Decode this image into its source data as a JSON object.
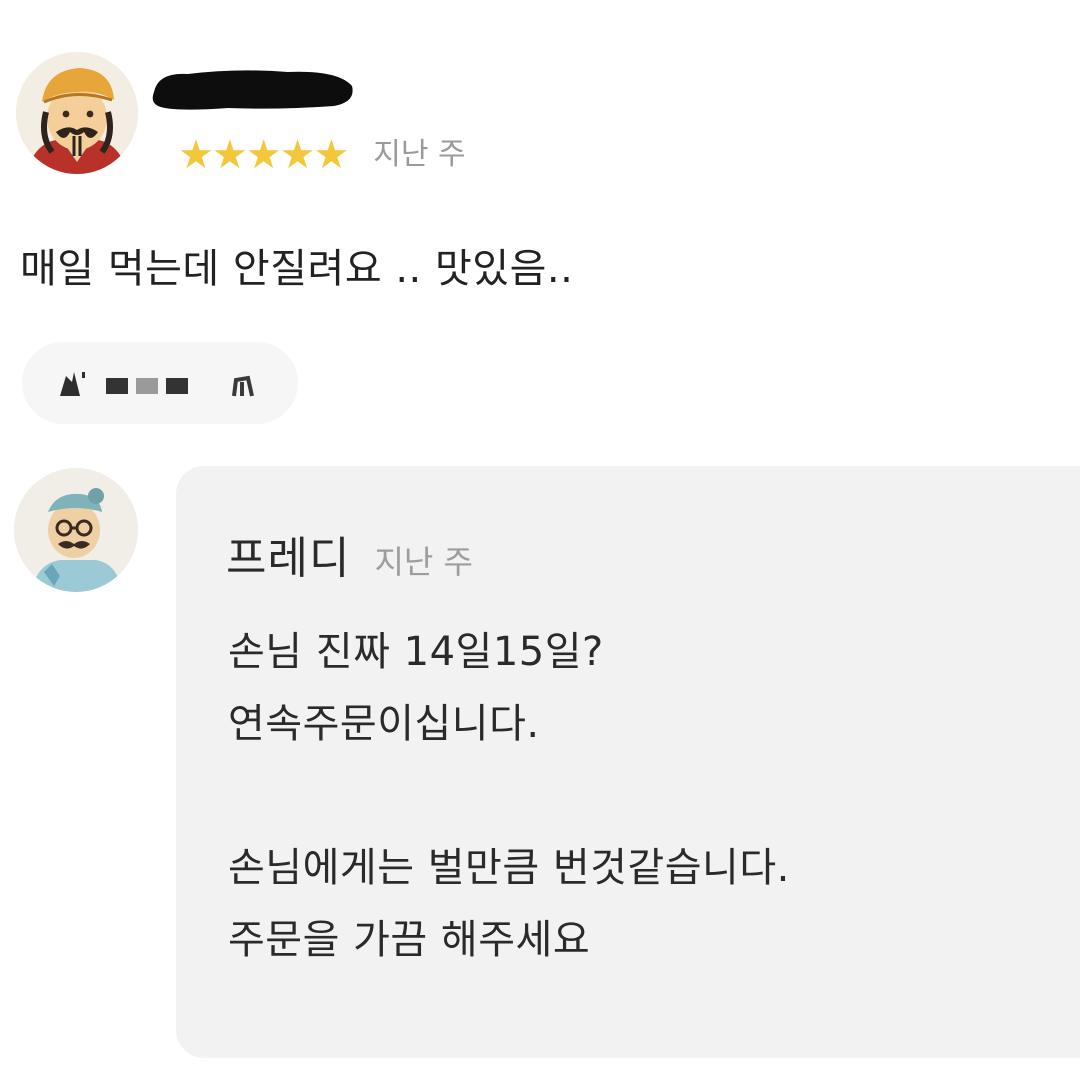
{
  "review": {
    "rating_stars": 5,
    "stars": [
      "★",
      "★",
      "★",
      "★",
      "★"
    ],
    "date": "지난 주",
    "text": "매일 먹는데 안질려요 .. 맛있음.."
  },
  "reply": {
    "author": "프레디",
    "date": "지난 주",
    "lines": [
      "손님 진짜 14일15일?",
      "연속주문이십니다.",
      "",
      "손님에게는 벌만큼 번것같습니다.",
      "주문을 가끔 해주세요"
    ]
  },
  "colors": {
    "star": "#f2c83a",
    "muted_text": "#9a9a9a",
    "body_text": "#222222",
    "reply_bubble": "#f2f2f2"
  },
  "icons": {
    "reviewer_avatar": "cartoon-character-avatar",
    "owner_avatar": "cartoon-character-avatar",
    "redaction": "black-marker-redaction",
    "menu_chip": "blurred-menu-tag"
  }
}
